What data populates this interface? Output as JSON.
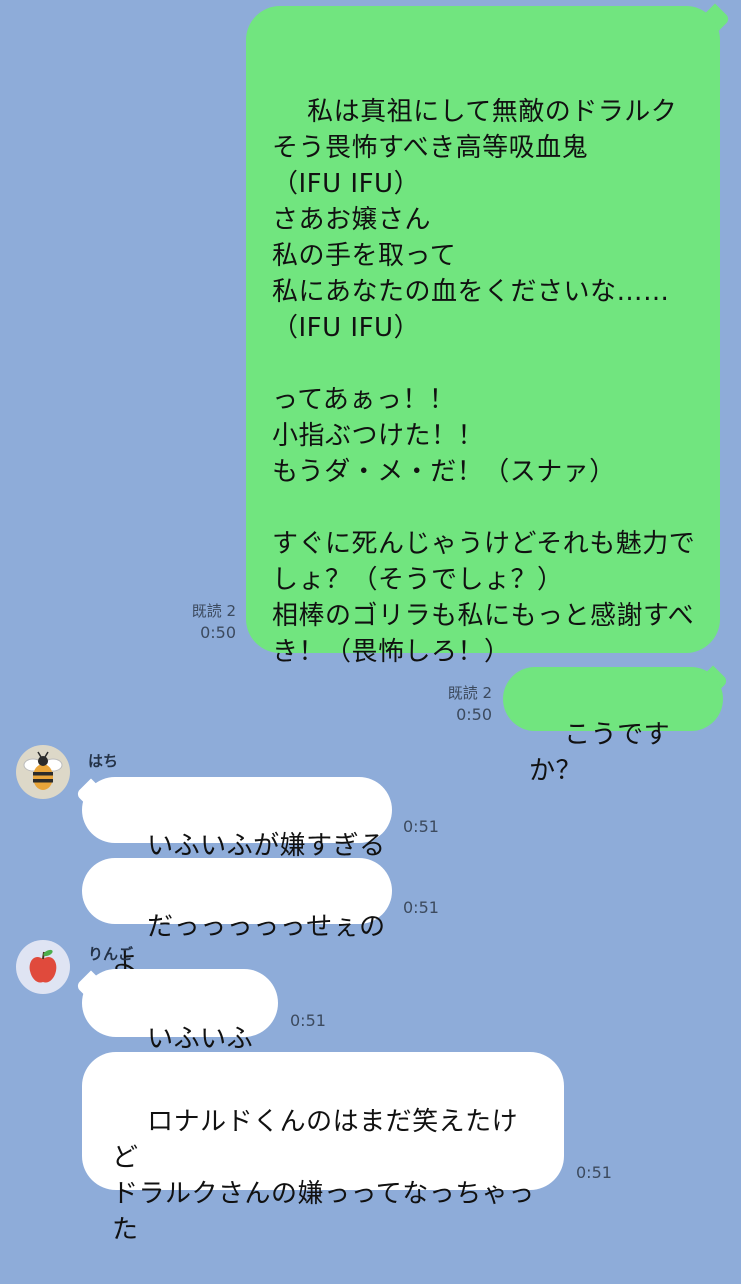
{
  "messages": {
    "m1": {
      "text": "私は真祖にして無敵のドラルク\nそう畏怖すべき高等吸血鬼\n（IFU IFU）\nさあお嬢さん\n私の手を取って\n私にあなたの血をくださいな……\n（IFU IFU）\n\nってあぁっ！！\n小指ぶつけた！！\nもうダ・メ・だ！（スナァ）\n\nすぐに死んじゃうけどそれも魅力でしょ？（そうでしょ？）\n相棒のゴリラも私にもっと感謝すべき！（畏怖しろ！）",
      "read": "既読 2",
      "time": "0:50"
    },
    "m2": {
      "text": "こうですか？",
      "read": "既読 2",
      "time": "0:50"
    },
    "m3": {
      "sender": "はち",
      "text": "いふいふが嫌すぎる",
      "time": "0:51"
    },
    "m4": {
      "text": "だっっっっっせぇのよ",
      "time": "0:51"
    },
    "m5": {
      "sender": "りんご",
      "text": "いふいふ嫌",
      "time": "0:51"
    },
    "m6": {
      "text": "ロナルドくんのはまだ笑えたけど\nドラルクさんの嫌っってなっちゃった",
      "time": "0:51"
    }
  },
  "colors": {
    "background": "#8eacd9",
    "outgoing_bubble": "#71e57f",
    "incoming_bubble": "#ffffff"
  },
  "icons": {
    "avatar_hachi": "bee-icon",
    "avatar_ringo": "apple-icon"
  }
}
